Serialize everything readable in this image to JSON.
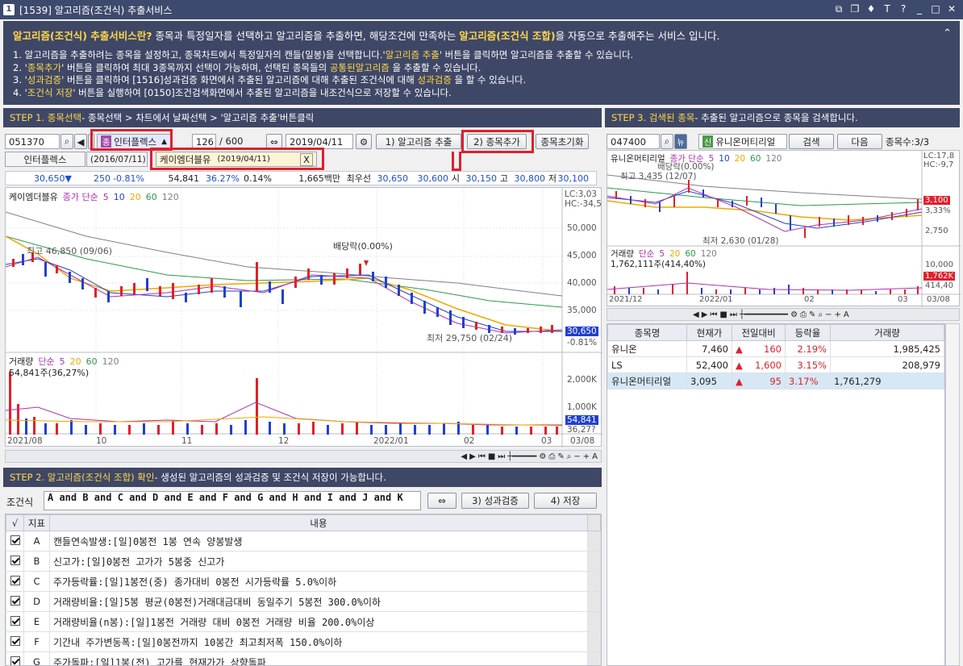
{
  "window": {
    "num": "1",
    "title": "[1539] 알고리즘(조건식) 추출서비스"
  },
  "info": {
    "heading_a": "알고리즘(조건식) 추출서비스란?",
    "heading_b": " 종목과 특정일자를 선택하고 알고리즘을 추출하면, 해당조건에 만족하는 ",
    "heading_c": "알고리즘(조건식 조합)",
    "heading_d": "을 자동으로 추출해주는 서비스 입니다.",
    "line1a": "1. 알고리즘을 추출하려는 종목을 설정하고, 종목차트에서 특정일자의 캔들(일봉)을 선택합니다.'",
    "line1b": "알고리즘 추출",
    "line1c": "' 버튼을 클릭하면 알고리즘을 추출할 수 있습니다.",
    "line2a": "2. '",
    "line2b": "종목추가",
    "line2c": "' 버튼을 클릭하여 최대 3종목까지 선택이 가능하며, 선택된 종목들의 ",
    "line2d": "공통된알고리즘",
    "line2e": " 을 추출할 수 있습니다.",
    "line3a": "3. '",
    "line3b": "성과검증",
    "line3c": "' 버튼을 클릭하여 [1516]성과검증 화면에서 추출된 알고리즘에 대해 추출된 조건식에 대해 ",
    "line3d": "성과검증",
    "line3e": " 을 할 수 있습니다.",
    "line4a": "4. '",
    "line4b": "조건식 저장",
    "line4c": "' 버튼을 실행하여 [0150]조건검색화면에서 추출된 알고리즘을 내조건식으로 저장할 수 있습니다."
  },
  "step1": {
    "a": "STEP 1. 종목선택",
    "b": " - 종목선택 > 차트에서 날짜선택 > '알고리즘 추출'버튼클릭"
  },
  "s1ctrl": {
    "code": "051370",
    "stock_badge": "종",
    "stock": "인터플렉스",
    "count": "126",
    "total": "/ 600",
    "date": "2019/04/11",
    "extract": "1) 알고리즘 추출",
    "add": "2) 종목추가",
    "reset": "종목초기화"
  },
  "s1row2": {
    "name": "인터플렉스",
    "date": "(2016/07/11)",
    "sel_name": "케이엠더블유",
    "sel_date": "(2019/04/11)",
    "close": "X"
  },
  "quote": {
    "price": "30,650▼",
    "chg": "250",
    "pct": "-0.81%",
    "vol": "54,841",
    "volpct": "36.27%",
    "turn": "0.14%",
    "amt": "1,665백만",
    "best": "최우선",
    "ask": "30,650",
    "bid": "30,600",
    "open_l": "시",
    "open": "30,150",
    "high_l": "고",
    "high": "30,800",
    "low_l": "저",
    "low": "30,100"
  },
  "chart1": {
    "name": "케이엠더블유",
    "ma_l": "종가 단순",
    "ma": [
      "5",
      "10",
      "20",
      "60",
      "120"
    ],
    "lc": "LC:3,03",
    "hc": "HC:-34,5",
    "yticks": [
      "50,000",
      "45,000",
      "40,000",
      "35,000",
      "30,650",
      "-0.81%"
    ],
    "hi": "최고 46,850 (09/06)",
    "div": "배당락(0.00%)",
    "lo": "최저 29,750 (02/24)",
    "vol_l": "거래량",
    "vol_ma": "단순",
    "vol_mas": [
      "5",
      "20",
      "60",
      "120"
    ],
    "vol_v": "54,841주(36,27%)",
    "vyticks": [
      "2,000K",
      "1,000K",
      "54,841",
      "36,27?"
    ],
    "xticks": [
      "2021/08",
      "10",
      "11",
      "12",
      "2022/01",
      "02",
      "03",
      "03/08"
    ]
  },
  "step2": {
    "a": "STEP 2. 알고리즘(조건식 조합) 확인",
    "b": " - 생성된 알고리즘의 성과검증 및 조건식 저장이 가능합니다."
  },
  "s2ctrl": {
    "label": "조건식",
    "expr": "A and B and C and D and E and F and G and H and I and J and K",
    "swap": "⇔",
    "verify": "3) 성과검증",
    "save": "4) 저장"
  },
  "conds": {
    "h1": "√",
    "h2": "지표",
    "h3": "내용",
    "rows": [
      {
        "k": "A",
        "t": "캔들연속발생:[일]0봉전 1봉 연속 양봉발생"
      },
      {
        "k": "B",
        "t": "신고가:[일]0봉전 고가가 5봉중 신고가"
      },
      {
        "k": "C",
        "t": "주가등락률:[일]1봉전(중) 종가대비 0봉전 시가등락률 5.0%이하"
      },
      {
        "k": "D",
        "t": "거래량비율:[일]5봉 평균(0봉전)거래대금대비 동일주기 5봉전 300.0%이하"
      },
      {
        "k": "E",
        "t": "거래량비율(n봉):[일]1봉전 거래량 대비 0봉전 거래량 비율 200.0%이상"
      },
      {
        "k": "F",
        "t": "기간내 주가변동폭:[일]0봉전까지 10봉간 최고최저폭 150.0%이하"
      },
      {
        "k": "G",
        "t": "주가돌파:[일]1봉(전) 고가를 현재가가 상향돌파"
      }
    ]
  },
  "step3": {
    "a": "STEP 3. 검색된 종목",
    "b": " - 추출된 알고리즘으로 종목을 검색합니다."
  },
  "s3ctrl": {
    "code": "047400",
    "badge1": "뉴",
    "badge2": "신",
    "stock": "유니온머티리얼",
    "search": "검색",
    "next": "다음",
    "count": "종목수:3/3"
  },
  "chart2": {
    "name": "유니온머티리얼",
    "ma_l": "종가 단순",
    "ma": [
      "5",
      "10",
      "20",
      "60",
      "120"
    ],
    "lc": "LC:17,8",
    "hc": "HC:-9,7",
    "div": "배당락(0.00%)",
    "hi": "최고 3,435 (12/07)",
    "lo": "최저 2,630 (01/28)",
    "yticks": [
      "3,100",
      "3,33%",
      "2,750"
    ],
    "vol_l": "거래량",
    "vol_ma": "단순",
    "vol_mas": [
      "5",
      "20",
      "60",
      "120"
    ],
    "vol_v": "1,762,111주(414,40%)",
    "vyticks": [
      "10,000",
      "1,762K",
      "414,40"
    ],
    "xticks": [
      "2021/12",
      "2022/01",
      "02",
      "03",
      "03/08"
    ]
  },
  "results": {
    "headers": [
      "종목명",
      "현재가",
      "전일대비",
      "등락율",
      "거래량"
    ],
    "rows": [
      {
        "name": "유니온",
        "price": "7,460",
        "chg": "160",
        "pct": "2.19%",
        "vol": "1,985,425"
      },
      {
        "name": "LS",
        "price": "52,400",
        "chg": "1,600",
        "pct": "3.15%",
        "vol": "208,979"
      },
      {
        "name": "유니온머티리얼",
        "price": "3,095",
        "chg": "95",
        "pct": "3.17%",
        "vol": "1,761,279"
      }
    ]
  }
}
